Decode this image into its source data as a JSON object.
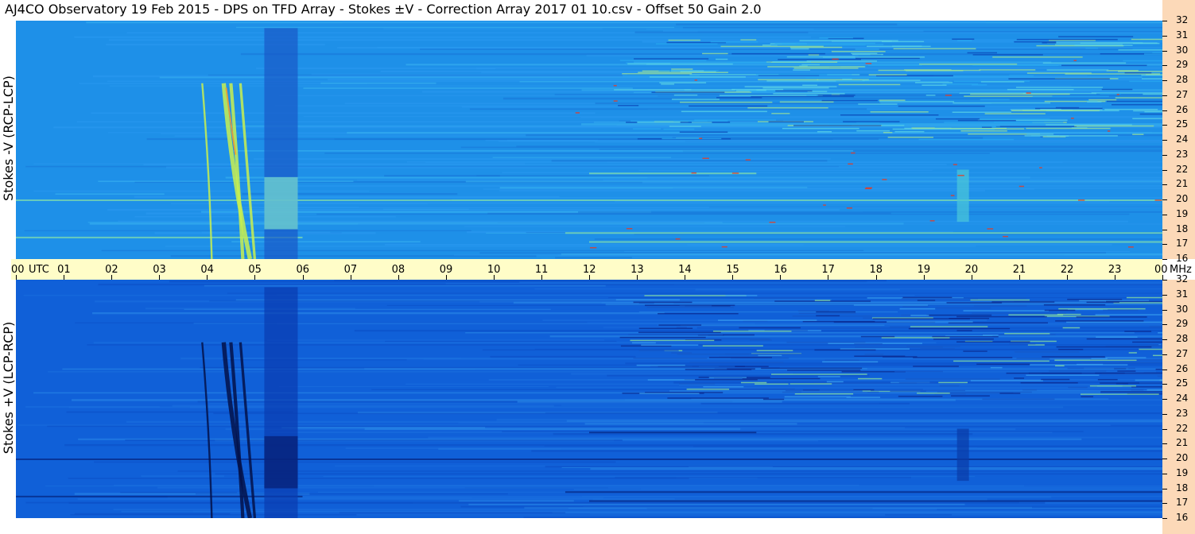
{
  "title": "AJ4CO Observatory  19 Feb 2015  -  DPS on TFD Array  -  Stokes ±V  -  Correction Array 2017 01 10.csv  -  Offset 50  Gain 2.0",
  "colors": {
    "background_top": "#1e90e8",
    "background_bottom": "#1060d8",
    "axis_strip": "#fffdc8",
    "freq_strip": "#fcd9b8"
  },
  "chart_data": [
    {
      "type": "heatmap",
      "panel": "top",
      "ylabel": "Stokes -V (RCP-LCP)",
      "x_ticks": [
        "00",
        "01",
        "02",
        "03",
        "04",
        "05",
        "06",
        "07",
        "08",
        "09",
        "10",
        "11",
        "12",
        "13",
        "14",
        "15",
        "16",
        "17",
        "18",
        "19",
        "20",
        "21",
        "22",
        "23",
        "00"
      ],
      "x_unit": "UTC",
      "y_ticks": [
        "32",
        "31",
        "30",
        "29",
        "28",
        "27",
        "26",
        "25",
        "24",
        "23",
        "22",
        "21",
        "20",
        "19",
        "18",
        "17",
        "16"
      ],
      "y_unit": "MHz",
      "xlim": [
        0,
        24
      ],
      "ylim": [
        16,
        32
      ]
    },
    {
      "type": "heatmap",
      "panel": "bottom",
      "ylabel": "Stokes +V (LCP-RCP)",
      "x_ticks": [
        "00",
        "01",
        "02",
        "03",
        "04",
        "05",
        "06",
        "07",
        "08",
        "09",
        "10",
        "11",
        "12",
        "13",
        "14",
        "15",
        "16",
        "17",
        "18",
        "19",
        "20",
        "21",
        "22",
        "23",
        "00"
      ],
      "x_unit": "UTC",
      "y_ticks": [
        "32",
        "31",
        "30",
        "29",
        "28",
        "27",
        "26",
        "25",
        "24",
        "23",
        "22",
        "21",
        "20",
        "19",
        "18",
        "17",
        "16"
      ],
      "y_unit": "MHz",
      "xlim": [
        0,
        24
      ],
      "ylim": [
        16,
        32
      ]
    }
  ]
}
